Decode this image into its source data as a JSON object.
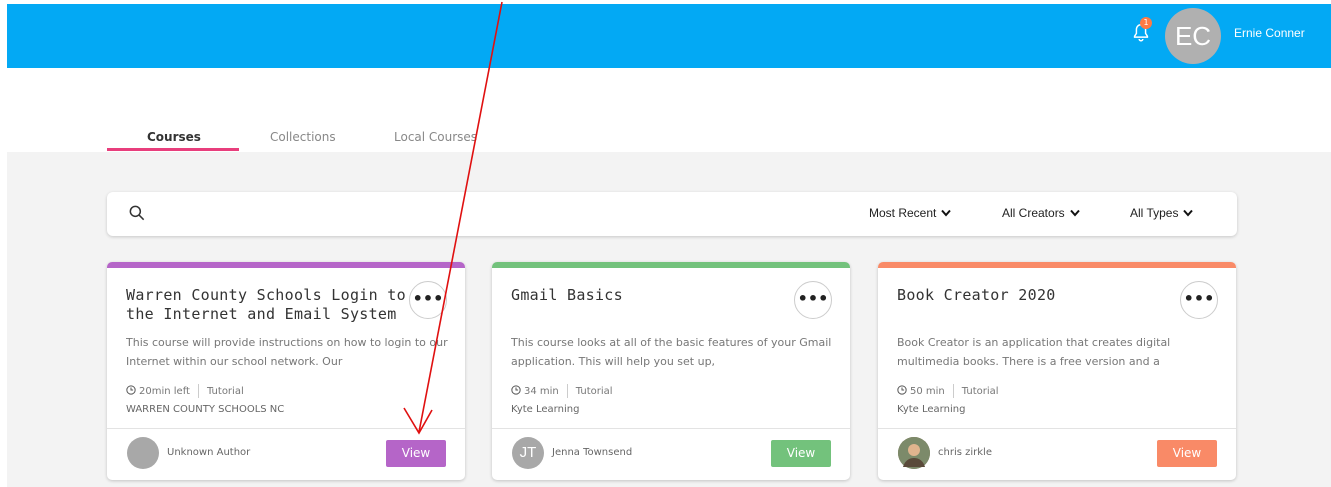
{
  "header": {
    "notification_count": "1",
    "user_initials": "EC",
    "user_name": "Ernie Conner",
    "brand_color": "#03a9f4"
  },
  "tabs": [
    {
      "label": "Courses",
      "active": true
    },
    {
      "label": "Collections",
      "active": false
    },
    {
      "label": "Local Courses",
      "active": false
    }
  ],
  "search": {
    "placeholder": "",
    "filters": [
      {
        "label": "Most Recent"
      },
      {
        "label": "All Creators"
      },
      {
        "label": "All Types"
      }
    ]
  },
  "cards": [
    {
      "title": "Warren County Schools Login to the Internet and Email System",
      "description": "This course will provide instructions on how to login to our Internet within our school network. Our",
      "duration": "20min left",
      "type": "Tutorial",
      "organization": "WARREN COUNTY SCHOOLS NC",
      "author": "Unknown Author",
      "author_initials": "",
      "view_label": "View",
      "accent": "#b565c8",
      "more_label": "•••"
    },
    {
      "title": "Gmail Basics",
      "description": "This course looks at all of the basic features of your Gmail application. This will help you set up,",
      "duration": "34 min",
      "type": "Tutorial",
      "organization": "Kyte Learning",
      "author": "Jenna Townsend",
      "author_initials": "JT",
      "view_label": "View",
      "accent": "#73c27c",
      "more_label": "•••"
    },
    {
      "title": "Book Creator 2020",
      "description": "Book Creator is an application that creates digital multimedia books. There is a free version and a",
      "duration": "50 min",
      "type": "Tutorial",
      "organization": "Kyte Learning",
      "author": "chris zirkle",
      "author_initials": "",
      "view_label": "View",
      "accent": "#f98a67",
      "more_label": "•••"
    }
  ],
  "annotation": {
    "arrow_color": "#e01010",
    "icon": "red-arrow-icon"
  }
}
